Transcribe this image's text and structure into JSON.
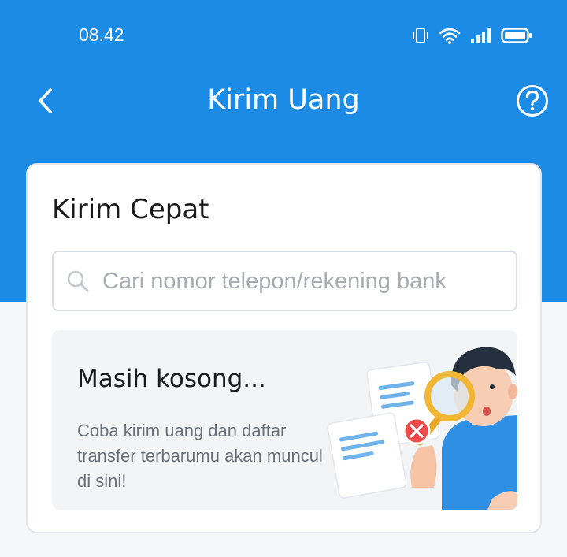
{
  "status_bar": {
    "time": "08.42",
    "icons": [
      "vibrate-icon",
      "wifi-icon",
      "signal-icon",
      "battery-icon"
    ]
  },
  "header": {
    "title": "Kirim Uang",
    "back_icon": "chevron-left-icon",
    "help_icon": "help-circle-icon"
  },
  "quick_send": {
    "title": "Kirim Cepat",
    "search": {
      "placeholder": "Cari nomor telepon/rekening bank",
      "value": ""
    },
    "empty_state": {
      "title": "Masih kosong...",
      "description": "Coba kirim uang dan daftar transfer terbarumu akan muncul di sini!"
    }
  },
  "colors": {
    "primary": "#1b8be6",
    "background": "#f6f7f8",
    "card": "#ffffff",
    "empty_panel": "#f3f4f6",
    "error": "#ef4b4b"
  }
}
